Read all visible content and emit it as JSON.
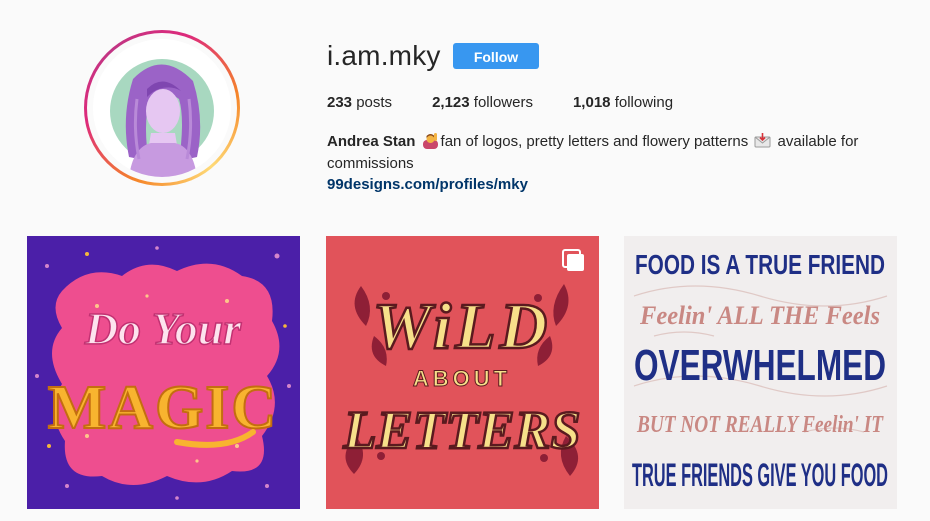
{
  "profile": {
    "username": "i.am.mky",
    "follow_label": "Follow",
    "stats": {
      "posts_count": "233",
      "posts_label": "posts",
      "followers_count": "2,123",
      "followers_label": "followers",
      "following_count": "1,018",
      "following_label": "following"
    },
    "full_name": "Andrea Stan",
    "bio_part1": "fan of logos, pretty letters and flowery patterns",
    "bio_part2": "available for commissions",
    "website": "99designs.com/profiles/mky",
    "icons": {
      "avatar": "avatar-icon",
      "bio_emoji_1": "person-raising-hand-icon",
      "bio_emoji_2": "envelope-icon"
    }
  },
  "posts": [
    {
      "line1": "Do Your",
      "line2": "MAGIC"
    },
    {
      "line1": "WiLD",
      "line2": "ABOUT",
      "line3": "LETTERS",
      "multi_icon": "multiple-photos-icon"
    },
    {
      "line1": "FOOD IS A TRUE FRIEND",
      "line2": "Feelin' ALL THE Feels",
      "line3": "OVERWHELMED",
      "line4": "BUT NOT REALLY Feelin' IT",
      "line5": "TRUE FRIENDS GIVE YOU FOOD"
    }
  ],
  "colors": {
    "follow_button": "#3897f0",
    "link": "#003569",
    "avatar_ring_start": "#f58529",
    "avatar_ring_end": "#dd2a7b"
  }
}
